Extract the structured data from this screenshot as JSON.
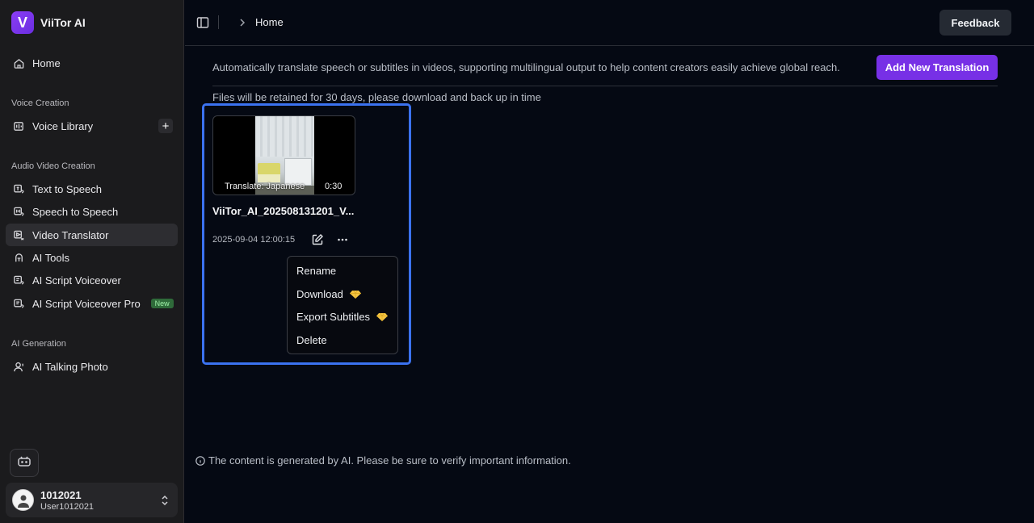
{
  "app": {
    "name": "ViiTor AI",
    "logo_letter": "V"
  },
  "sidebar": {
    "home": "Home",
    "sections": [
      {
        "label": "Voice Creation"
      },
      {
        "label": "Audio Video Creation"
      },
      {
        "label": "AI Generation"
      }
    ],
    "voice_library": "Voice Library",
    "items": [
      {
        "label": "Text to Speech"
      },
      {
        "label": "Speech to Speech"
      },
      {
        "label": "Video Translator"
      },
      {
        "label": "AI Tools"
      },
      {
        "label": "AI Script Voiceover"
      },
      {
        "label": "AI Script Voiceover Pro"
      }
    ],
    "new_badge": "New",
    "talking_photo": "AI Talking Photo",
    "active_item": "Video Translator"
  },
  "user": {
    "name": "1012021",
    "handle": "User1012021"
  },
  "topbar": {
    "breadcrumb": "Home",
    "feedback": "Feedback"
  },
  "main": {
    "description": "Automatically translate speech or subtitles in videos, supporting multilingual output to help content creators easily achieve global reach.",
    "add_button": "Add New Translation",
    "retention_note": "Files will be retained for 30 days, please download and back up in time"
  },
  "file_card": {
    "thumbnail_caption": "Translate: Japanese",
    "duration": "0:30",
    "name": "ViiTor_AI_202508131201_V...",
    "date": "2025-09-04 12:00:15"
  },
  "context_menu": {
    "items": [
      {
        "label": "Rename",
        "premium": false
      },
      {
        "label": "Download",
        "premium": true
      },
      {
        "label": "Export Subtitles",
        "premium": true
      },
      {
        "label": "Delete",
        "premium": false
      }
    ]
  },
  "footer": {
    "note": "The content is generated by AI. Please be sure to verify important information."
  },
  "colors": {
    "accent": "#7730e6",
    "highlight": "#3b72f0",
    "premium": "#f5c542"
  }
}
